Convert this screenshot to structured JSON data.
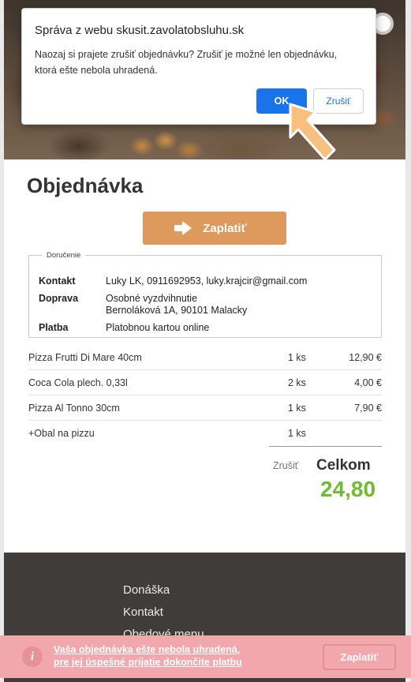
{
  "dialog": {
    "title": "Správa z webu skusit.zavolatobsluhu.sk",
    "message_line1": "Naozaj si prajete zrušiť objednávku? Zrušiť je možné len objednávku,",
    "message_line2": "ktorá ešte nebola uhradená.",
    "ok_label": "OK",
    "cancel_label": "Zrušiť"
  },
  "page": {
    "title": "Objednávka"
  },
  "pay_button": {
    "label": "Zaplatiť"
  },
  "delivery": {
    "legend": "Doručenie",
    "contact_label": "Kontakt",
    "contact_value": "Luky LK, 0911692953, luky.krajcir@gmail.com",
    "shipping_label": "Doprava",
    "shipping_method": "Osobné vyzdvihnutie",
    "shipping_address": "Bernoláková 1A, 90101 Malacky",
    "payment_label": "Platba",
    "payment_value": "Platobnou kartou online"
  },
  "items": [
    {
      "name": "Pizza Frutti Di Mare 40cm",
      "qty": "1 ks",
      "price": "12,90 €"
    },
    {
      "name": "Coca Cola plech. 0,33l",
      "qty": "2 ks",
      "price": "4,00 €"
    },
    {
      "name": "Pizza Al Tonno 30cm",
      "qty": "1 ks",
      "price": "7,90 €"
    },
    {
      "name": "+Obal na pizzu",
      "qty": "1 ks",
      "price": ""
    }
  ],
  "summary": {
    "cancel_link": "Zrušiť",
    "total_label": "Celkom",
    "total_value": "24,80"
  },
  "footer": {
    "links": [
      "Donáška",
      "Kontakt",
      "Obedové menu"
    ]
  },
  "notice": {
    "line1": "Vaša objednávka ešte nebola uhradená,",
    "line2": "pre jej úspešné prijatie dokončite platbu",
    "button_label": "Zaplatiť",
    "icon": "info-icon"
  },
  "colors": {
    "accent": "#dd9a5c",
    "total": "#6dbd2f",
    "dialog_ok": "#1a73e8",
    "notice_bg": "#f2a7ac",
    "footer_bg": "#403c39"
  }
}
